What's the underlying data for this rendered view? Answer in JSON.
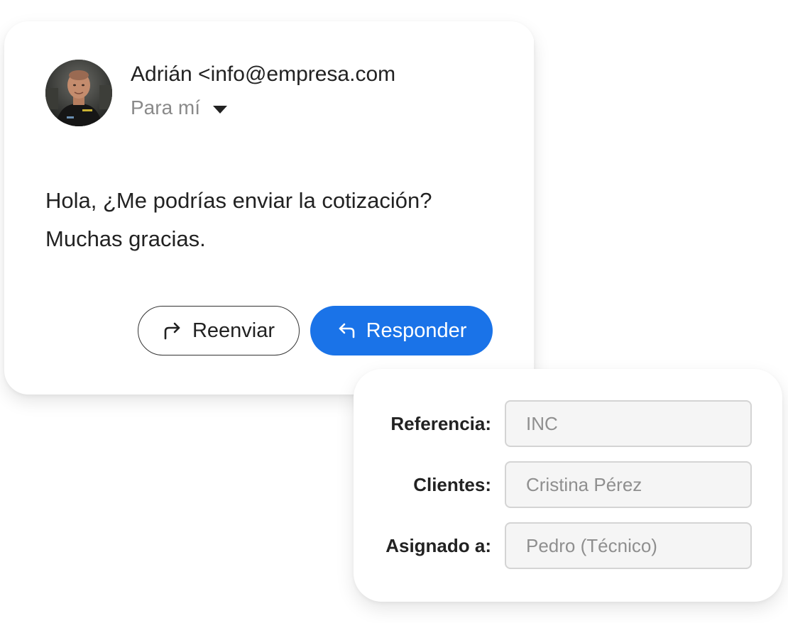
{
  "email": {
    "sender": "Adrián <info@empresa.com",
    "recipient_label": "Para mí",
    "recipient_dropdown_icon": "caret-down-icon",
    "avatar_icon": "avatar",
    "body_lines": [
      "Hola, ¿Me podrías enviar la cotización?",
      "Muchas gracias."
    ],
    "forward_button": {
      "label": "Reenviar",
      "icon": "forward-arrow-icon"
    },
    "reply_button": {
      "label": "Responder",
      "icon": "reply-arrow-icon"
    }
  },
  "form": {
    "fields": [
      {
        "label": "Referencia:",
        "placeholder": "INC"
      },
      {
        "label": "Clientes:",
        "placeholder": "Cristina Pérez"
      },
      {
        "label": "Asignado a:",
        "placeholder": "Pedro (Técnico)"
      }
    ]
  },
  "colors": {
    "primary": "#1a73e8",
    "text": "#222222",
    "muted": "#8a8a8a",
    "field_bg": "#f5f5f5",
    "field_border": "#d4d4d4"
  }
}
